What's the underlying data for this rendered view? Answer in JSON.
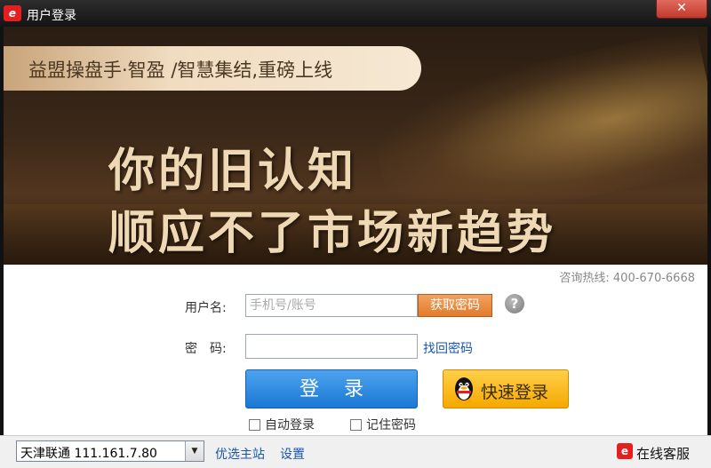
{
  "window": {
    "title": "用户登录",
    "close_label": "✕"
  },
  "banner": {
    "slogan": "益盟操盘手·智盈 /智慧集结,重磅上线",
    "headline_line1": "你的旧认知",
    "headline_line2": "顺应不了市场新趋势"
  },
  "hotline": "咨询热线:  400-670-6668",
  "form": {
    "username_label": "用户名:",
    "username_placeholder": "手机号/账号",
    "password_label": "密　码:",
    "get_password_label": "获取密码",
    "help_label": "?",
    "recover_password_label": "找回密码",
    "login_label": "登录",
    "quick_login_label": "快速登录",
    "auto_login_label": "自动登录",
    "remember_password_label": "记住密码"
  },
  "footer": {
    "server_value": "天津联通 111.161.7.80",
    "preferred_server_label": "优选主站",
    "settings_label": "设置",
    "online_service_label": "在线客服"
  },
  "colors": {
    "login_button": "#1a78d4",
    "quick_login_button": "#f5a800",
    "get_password_button": "#e07b2c",
    "close_button": "#c0392b"
  }
}
